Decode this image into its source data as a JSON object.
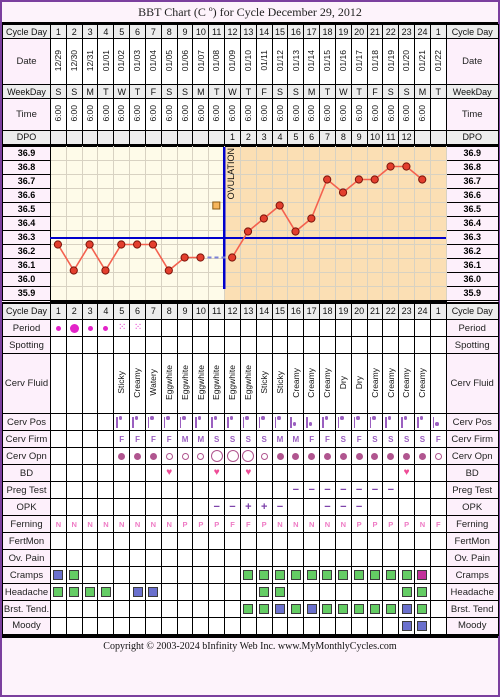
{
  "title": "BBT Chart (C º) for Cycle December 29, 2012",
  "footer": "Copyright © 2003-2024 bInfinity Web Inc.    www.MyMonthlyCycles.com",
  "labels": {
    "cycle_day": "Cycle Day",
    "date": "Date",
    "weekday": "WeekDay",
    "time": "Time",
    "dpo": "DPO",
    "period": "Period",
    "spotting": "Spotting",
    "cerv_fluid": "Cerv Fluid",
    "cerv_pos": "Cerv Pos",
    "cerv_firm": "Cerv Firm",
    "cerv_opn": "Cerv Opn",
    "bd": "BD",
    "preg_test": "Preg Test",
    "opk": "OPK",
    "ferning": "Ferning",
    "fertmon": "FertMon",
    "ov_pain": "Ov. Pain",
    "cramps": "Cramps",
    "headache": "Headache",
    "brst_tend": "Brst. Tend.",
    "brst_tend_right": "Brst. Tend",
    "moody": "Moody",
    "ovulation": "OVULATION"
  },
  "colors": {
    "border": "#7b3f9e",
    "panel_bg": "#fdf3fb",
    "label_bg": "#fdf0fb",
    "header_bg": "#ededed",
    "pre_ov_bg": "#fefbe9",
    "post_ov_bg": "#fbdfb4",
    "temp_line": "#f4614f",
    "temp_dot": "#e33f2e",
    "coverline": "#0000cc",
    "period": "#e324c8",
    "green": "#64cd64",
    "blue": "#6a70cd",
    "magenta": "#c3309b",
    "cerv": "#9b5fc0",
    "heart": "#ee4d97",
    "opk": "#7b3fa8",
    "ferning": "#ee7bc4"
  },
  "chart_data": {
    "type": "line",
    "title": "BBT Chart (C º) for Cycle December 29, 2012",
    "xlabel": "Cycle Day",
    "ylabel": "Temperature (Cº)",
    "ylim": [
      35.9,
      36.9
    ],
    "ytick_labels": [
      "36.9",
      "36.8",
      "36.7",
      "36.6",
      "36.5",
      "36.4",
      "36.3",
      "36.2",
      "36.1",
      "36.0",
      "35.9"
    ],
    "grid": true,
    "coverline": 36.25,
    "ovulation_day": 12,
    "x": [
      1,
      2,
      3,
      4,
      5,
      6,
      7,
      8,
      9,
      10,
      11,
      12,
      13,
      14,
      15,
      16,
      17,
      18,
      19,
      20,
      21,
      22,
      23,
      24
    ],
    "values": [
      36.2,
      36.0,
      36.2,
      36.0,
      36.2,
      36.2,
      36.2,
      36.0,
      36.1,
      36.1,
      null,
      36.1,
      36.3,
      36.4,
      36.5,
      36.3,
      36.4,
      36.7,
      36.6,
      36.7,
      36.7,
      36.8,
      36.8,
      36.7
    ],
    "dashed_segments": [
      [
        10,
        36.1
      ],
      [
        12,
        36.1
      ]
    ],
    "extra_markers": [
      {
        "day": 11,
        "value": 36.5,
        "style": "orange-square"
      }
    ]
  },
  "columns": {
    "cycle_day": [
      "1",
      "2",
      "3",
      "4",
      "5",
      "6",
      "7",
      "8",
      "9",
      "10",
      "11",
      "12",
      "13",
      "14",
      "15",
      "16",
      "17",
      "18",
      "19",
      "20",
      "21",
      "22",
      "23",
      "24",
      "1"
    ],
    "date": [
      "12/29",
      "12/30",
      "12/31",
      "01/01",
      "01/02",
      "01/03",
      "01/04",
      "01/05",
      "01/06",
      "01/07",
      "01/08",
      "01/09",
      "01/10",
      "01/11",
      "01/12",
      "01/13",
      "01/14",
      "01/15",
      "01/16",
      "01/17",
      "01/18",
      "01/19",
      "01/20",
      "01/21",
      "01/22"
    ],
    "weekday": [
      "S",
      "S",
      "M",
      "T",
      "W",
      "T",
      "F",
      "S",
      "S",
      "M",
      "T",
      "W",
      "T",
      "F",
      "S",
      "S",
      "M",
      "T",
      "W",
      "T",
      "F",
      "S",
      "S",
      "M",
      "T"
    ],
    "time": [
      "6:00",
      "6:00",
      "6:00",
      "6:00",
      "6:00",
      "6:00",
      "6:00",
      "6:00",
      "6:00",
      "6:00",
      "6:00",
      "6:00",
      "6:00",
      "6:00",
      "6:00",
      "6:00",
      "6:00",
      "6:00",
      "6:00",
      "6:00",
      "6:00",
      "6:00",
      "6:00",
      "6:00",
      ""
    ],
    "dpo": [
      "",
      "",
      "",
      "",
      "",
      "",
      "",
      "",
      "",
      "",
      "",
      "1",
      "2",
      "3",
      "4",
      "5",
      "6",
      "7",
      "8",
      "9",
      "10",
      "11",
      "12",
      ""
    ],
    "period": [
      "small",
      "large",
      "small",
      "small",
      "spot",
      "spot",
      "",
      "",
      "",
      "",
      "",
      "",
      "",
      "",
      "",
      "",
      "",
      "",
      "",
      "",
      "",
      "",
      "",
      "",
      ""
    ],
    "spotting": [
      "",
      "",
      "",
      "",
      "",
      "",
      "",
      "",
      "",
      "",
      "",
      "",
      "",
      "",
      "",
      "",
      "",
      "",
      "",
      "",
      "",
      "",
      "",
      "",
      ""
    ],
    "cerv_fluid": [
      "",
      "",
      "",
      "",
      "Sticky",
      "Creamy",
      "Watery",
      "Eggwhite",
      "Eggwhite",
      "Eggwhite",
      "Eggwhite",
      "Eggwhite",
      "Eggwhite",
      "Sticky",
      "Sticky",
      "Creamy",
      "Creamy",
      "Creamy",
      "Dry",
      "Dry",
      "Creamy",
      "Creamy",
      "Creamy",
      "Creamy",
      ""
    ],
    "cerv_pos": [
      "",
      "",
      "",
      "",
      "high",
      "high",
      "high",
      "high",
      "high",
      "high",
      "high",
      "high",
      "high",
      "high",
      "high",
      "mid",
      "mid",
      "high",
      "high",
      "high",
      "high",
      "high",
      "high",
      "high",
      "mid"
    ],
    "cerv_firm": [
      "",
      "",
      "",
      "",
      "F",
      "F",
      "F",
      "F",
      "M",
      "M",
      "S",
      "S",
      "S",
      "S",
      "M",
      "M",
      "F",
      "F",
      "S",
      "F",
      "S",
      "S",
      "S",
      "S",
      "F",
      "M"
    ],
    "cerv_opn": [
      "",
      "",
      "",
      "",
      "closed",
      "closed",
      "closed",
      "open-sm",
      "open-sm",
      "open-sm",
      "open-lg",
      "open-lg",
      "open-lg",
      "open-sm",
      "closed",
      "closed",
      "closed",
      "closed",
      "closed",
      "closed",
      "closed",
      "closed",
      "closed",
      "closed",
      "open-sm"
    ],
    "bd": [
      "",
      "",
      "",
      "",
      "",
      "",
      "",
      "heart",
      "",
      "",
      "heart",
      "",
      "heart",
      "",
      "",
      "",
      "",
      "",
      "",
      "",
      "",
      "",
      "heart",
      "",
      ""
    ],
    "preg_test": [
      "",
      "",
      "",
      "",
      "",
      "",
      "",
      "",
      "",
      "",
      "",
      "",
      "",
      "",
      "",
      "dash",
      "dash",
      "dash",
      "dash",
      "dash",
      "dash",
      "dash",
      "",
      "",
      ""
    ],
    "opk": [
      "",
      "",
      "",
      "",
      "",
      "",
      "",
      "",
      "",
      "",
      "minus",
      "minus",
      "plus",
      "plus",
      "minus",
      "",
      "",
      "dash",
      "dash",
      "dash",
      "",
      "",
      "",
      "",
      ""
    ],
    "ferning": [
      "N",
      "N",
      "N",
      "N",
      "N",
      "N",
      "N",
      "N",
      "P",
      "P",
      "P",
      "F",
      "F",
      "P",
      "N",
      "N",
      "N",
      "N",
      "N",
      "P",
      "P",
      "P",
      "P",
      "N",
      "F",
      "P"
    ],
    "fertmon": [
      "",
      "",
      "",
      "",
      "",
      "",
      "",
      "",
      "",
      "",
      "",
      "",
      "",
      "",
      "",
      "",
      "",
      "",
      "",
      "",
      "",
      "",
      "",
      "",
      ""
    ],
    "ov_pain": [
      "",
      "",
      "",
      "",
      "",
      "",
      "",
      "",
      "",
      "",
      "",
      "",
      "",
      "",
      "",
      "",
      "",
      "",
      "",
      "",
      "",
      "",
      "",
      "",
      ""
    ],
    "cramps": [
      "blue",
      "green",
      "",
      "",
      "",
      "",
      "",
      "",
      "",
      "",
      "",
      "",
      "green",
      "green",
      "green",
      "green",
      "green",
      "green",
      "green",
      "green",
      "green",
      "green",
      "green",
      "magenta",
      ""
    ],
    "headache": [
      "green",
      "green",
      "green",
      "green",
      "",
      "blue",
      "blue",
      "",
      "",
      "",
      "",
      "",
      "",
      "green",
      "green",
      "",
      "",
      "",
      "",
      "",
      "",
      "",
      "green",
      "green",
      ""
    ],
    "brst_tend": [
      "",
      "",
      "",
      "",
      "",
      "",
      "",
      "",
      "",
      "",
      "",
      "",
      "green",
      "green",
      "blue",
      "green",
      "blue",
      "green",
      "green",
      "green",
      "green",
      "green",
      "blue",
      "green",
      ""
    ],
    "moody": [
      "",
      "",
      "",
      "",
      "",
      "",
      "",
      "",
      "",
      "",
      "",
      "",
      "",
      "",
      "",
      "",
      "",
      "",
      "",
      "",
      "",
      "",
      "blue",
      "blue",
      ""
    ]
  }
}
